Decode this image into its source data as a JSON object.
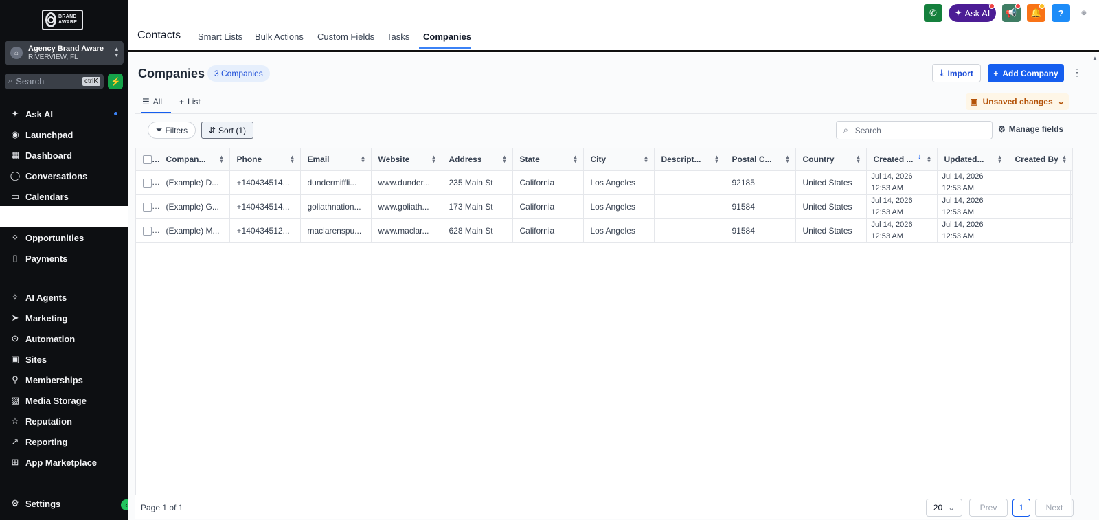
{
  "brand": {
    "logo_text": "BRAND AWARE"
  },
  "account": {
    "name": "Agency Brand Aware",
    "location": "RIVERVIEW, FL"
  },
  "sidebar_search": {
    "placeholder": "Search",
    "shortcut": "ctrlK"
  },
  "sidebar": {
    "items": [
      {
        "label": "Ask AI",
        "icon": "sparkles-icon",
        "glyph": "✦"
      },
      {
        "label": "Launchpad",
        "icon": "rocket-icon",
        "glyph": "◉"
      },
      {
        "label": "Dashboard",
        "icon": "dashboard-icon",
        "glyph": "▦"
      },
      {
        "label": "Conversations",
        "icon": "chat-icon",
        "glyph": "◯"
      },
      {
        "label": "Calendars",
        "icon": "calendar-icon",
        "glyph": "▭"
      },
      {
        "label": "Opportunities",
        "icon": "funnel-icon",
        "glyph": "⁘"
      },
      {
        "label": "Payments",
        "icon": "receipt-icon",
        "glyph": "▯"
      },
      {
        "label": "AI Agents",
        "icon": "ai-agents-icon",
        "glyph": "✧"
      },
      {
        "label": "Marketing",
        "icon": "send-icon",
        "glyph": "➤"
      },
      {
        "label": "Automation",
        "icon": "automation-icon",
        "glyph": "⊙"
      },
      {
        "label": "Sites",
        "icon": "sites-icon",
        "glyph": "▣"
      },
      {
        "label": "Memberships",
        "icon": "badge-icon",
        "glyph": "⚲"
      },
      {
        "label": "Media Storage",
        "icon": "image-icon",
        "glyph": "▨"
      },
      {
        "label": "Reputation",
        "icon": "star-icon",
        "glyph": "☆"
      },
      {
        "label": "Reporting",
        "icon": "trend-icon",
        "glyph": "↗"
      },
      {
        "label": "App Marketplace",
        "icon": "apps-icon",
        "glyph": "⊞"
      }
    ],
    "settings": {
      "label": "Settings",
      "icon": "gear-icon",
      "glyph": "⚙"
    }
  },
  "header": {
    "title": "Contacts",
    "tabs": [
      {
        "label": "Smart Lists"
      },
      {
        "label": "Bulk Actions"
      },
      {
        "label": "Custom Fields"
      },
      {
        "label": "Tasks"
      },
      {
        "label": "Companies"
      }
    ],
    "active_tab": "Companies",
    "ask_ai_label": "Ask AI",
    "help_label": "?"
  },
  "page": {
    "title": "Companies",
    "count_badge": "3 Companies",
    "import_label": "Import",
    "add_label": "Add Company",
    "views": [
      {
        "label": "All"
      },
      {
        "label": "List"
      }
    ],
    "unsaved_label": "Unsaved changes",
    "filters_label": "Filters",
    "sort_label": "Sort (1)",
    "search_placeholder": "Search",
    "manage_fields_label": "Manage fields"
  },
  "table": {
    "columns": [
      "Compan...",
      "Phone",
      "Email",
      "Website",
      "Address",
      "State",
      "City",
      "Descript...",
      "Postal C...",
      "Country",
      "Created ...",
      "Updated...",
      "Created By"
    ],
    "rows": [
      {
        "company": "(Example) D...",
        "phone": "+140434514...",
        "email": "dundermiffli...",
        "website": "www.dunder...",
        "address": "235 Main St",
        "state": "California",
        "city": "Los Angeles",
        "description": "",
        "postal": "92185",
        "country": "United States",
        "created_date": "Jul 14, 2026",
        "created_time": "12:53 AM",
        "updated_date": "Jul 14, 2026",
        "updated_time": "12:53 AM",
        "created_by": ""
      },
      {
        "company": "(Example) G...",
        "phone": "+140434514...",
        "email": "goliathnation...",
        "website": "www.goliath...",
        "address": "173 Main St",
        "state": "California",
        "city": "Los Angeles",
        "description": "",
        "postal": "91584",
        "country": "United States",
        "created_date": "Jul 14, 2026",
        "created_time": "12:53 AM",
        "updated_date": "Jul 14, 2026",
        "updated_time": "12:53 AM",
        "created_by": ""
      },
      {
        "company": "(Example) M...",
        "phone": "+140434512...",
        "email": "maclarenspu...",
        "website": "www.maclar...",
        "address": "628 Main St",
        "state": "California",
        "city": "Los Angeles",
        "description": "",
        "postal": "91584",
        "country": "United States",
        "created_date": "Jul 14, 2026",
        "created_time": "12:53 AM",
        "updated_date": "Jul 14, 2026",
        "updated_time": "12:53 AM",
        "created_by": ""
      }
    ]
  },
  "pagination": {
    "text": "Page 1 of 1",
    "page_size": "20",
    "prev": "Prev",
    "current": "1",
    "next": "Next"
  },
  "colors": {
    "sidebar_bg": "#0d0f12",
    "primary": "#155eef",
    "ask_ai": "#5b21b6",
    "phone_btn": "#15803d",
    "notif_btn": "#f97316",
    "help_btn": "#1d8cf8",
    "warning_bg": "#fef6e7"
  }
}
